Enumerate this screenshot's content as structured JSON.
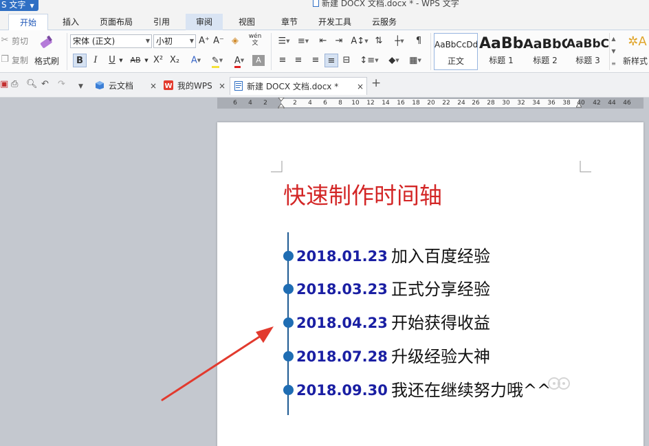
{
  "app": {
    "menu_label": "S 文字",
    "window_title": "新建 DOCX 文档.docx * - WPS 文字"
  },
  "ribbon_tabs": [
    {
      "label": "开始",
      "state": "active"
    },
    {
      "label": "插入"
    },
    {
      "label": "页面布局"
    },
    {
      "label": "引用"
    },
    {
      "label": "审阅",
      "state": "hover"
    },
    {
      "label": "视图"
    },
    {
      "label": "章节"
    },
    {
      "label": "开发工具"
    },
    {
      "label": "云服务"
    }
  ],
  "clipboard": {
    "cut_label": "剪切",
    "copy_label": "复制",
    "format_painter_label": "格式刷"
  },
  "font": {
    "font_name": "宋体 (正文)",
    "font_size": "小初",
    "bold": "B",
    "italic": "I",
    "underline": "U",
    "strike": "AB",
    "superscript": "X²",
    "subscript": "X₂",
    "grow": "A⁺",
    "shrink": "A⁻",
    "phonetic": "wén"
  },
  "styles": [
    {
      "sample": "AaBbCcDd",
      "name": "正文",
      "selected": true
    },
    {
      "sample": "AaBb",
      "name": "标题 1"
    },
    {
      "sample": "AaBbC",
      "name": "标题 2"
    },
    {
      "sample": "AaBbC",
      "name": "标题 3"
    }
  ],
  "new_style_label": "新样式",
  "doc_tabs": [
    {
      "label": "云文档",
      "icon": "cloud-doc-icon"
    },
    {
      "label": "我的WPS",
      "icon": "wps-logo-icon"
    },
    {
      "label": "新建 DOCX 文档.docx *",
      "icon": "docx-icon",
      "active": true
    }
  ],
  "ruler_numbers": [
    "6",
    "4",
    "2",
    "2",
    "4",
    "6",
    "8",
    "10",
    "12",
    "14",
    "16",
    "18",
    "20",
    "22",
    "24",
    "26",
    "28",
    "30",
    "32",
    "34",
    "36",
    "38",
    "40",
    "42",
    "44",
    "46"
  ],
  "document": {
    "heading": "快速制作时间轴",
    "timeline": [
      {
        "date": "2018.01.23",
        "text": "加入百度经验"
      },
      {
        "date": "2018.03.23",
        "text": "正式分享经验"
      },
      {
        "date": "2018.04.23",
        "text": "开始获得收益"
      },
      {
        "date": "2018.07.28",
        "text": "升级经验大神"
      },
      {
        "date": "2018.09.30",
        "text": "我还在继续努力哦^^"
      }
    ]
  },
  "colors": {
    "heading": "#d32626",
    "date": "#1a1fa3",
    "timeline": "#1e5a92",
    "dot": "#1f6db3",
    "arrow": "#e23a2e",
    "accent": "#2f6fc4"
  }
}
